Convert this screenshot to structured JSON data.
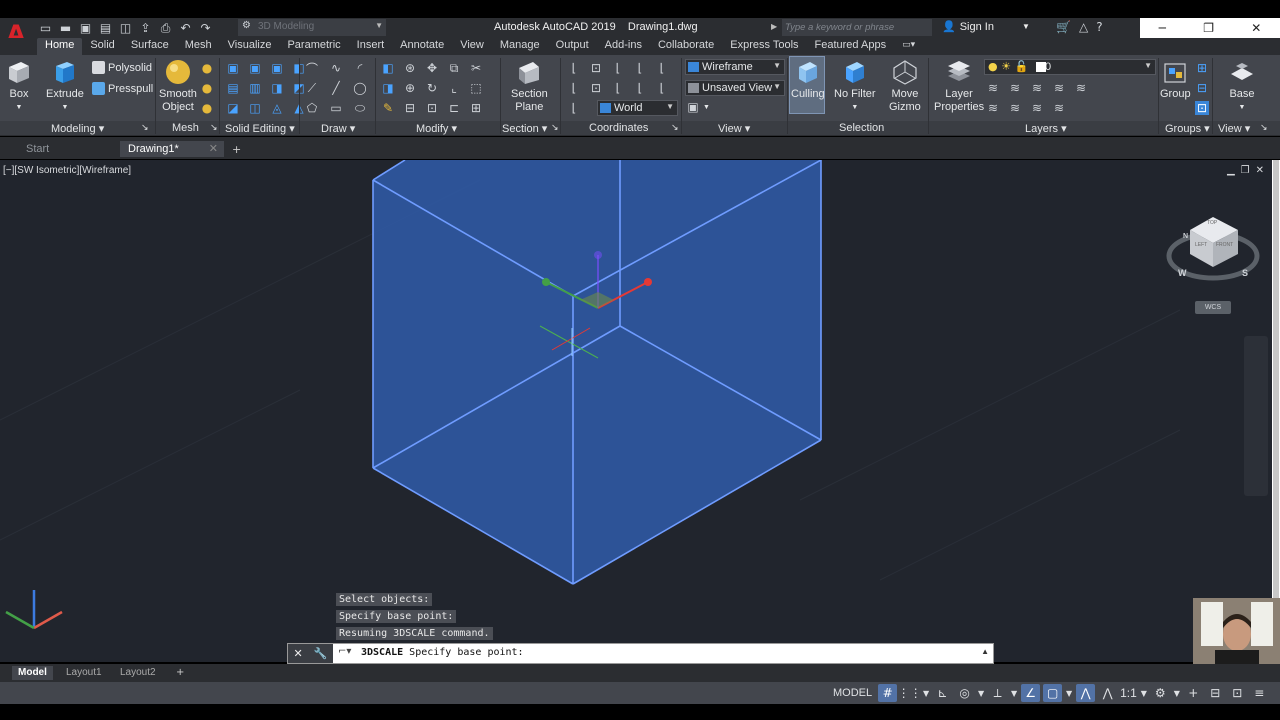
{
  "window": {
    "app_letter": "A",
    "title": "Autodesk AutoCAD 2019    Drawing1.dwg",
    "workspace": "3D Modeling",
    "search_placeholder": "Type a keyword or phrase",
    "sign_in": "Sign In"
  },
  "ribbon_tabs": [
    "Home",
    "Solid",
    "Surface",
    "Mesh",
    "Visualize",
    "Parametric",
    "Insert",
    "Annotate",
    "View",
    "Manage",
    "Output",
    "Add-ins",
    "Collaborate",
    "Express Tools",
    "Featured Apps"
  ],
  "ribbon": {
    "modeling": {
      "box": "Box",
      "extrude": "Extrude",
      "polysolid": "Polysolid",
      "presspull": "Presspull",
      "label": "Modeling ▾"
    },
    "mesh": {
      "smooth_object": "Smooth\nObject",
      "label": "Mesh"
    },
    "solid_editing": {
      "label": "Solid Editing ▾"
    },
    "draw": {
      "label": "Draw ▾"
    },
    "modify": {
      "label": "Modify ▾"
    },
    "section": {
      "section_plane": "Section\nPlane",
      "label": "Section ▾"
    },
    "coordinates": {
      "ucs": "World",
      "label": "Coordinates"
    },
    "view": {
      "visual_style": "Wireframe",
      "named_view": "Unsaved View",
      "label": "View ▾"
    },
    "selection": {
      "culling": "Culling",
      "no_filter": "No Filter",
      "move_gizmo": "Move\nGizmo",
      "label": "Selection"
    },
    "layers": {
      "layer_properties": "Layer\nProperties",
      "current_layer": "0",
      "label": "Layers ▾"
    },
    "groups": {
      "group": "Group",
      "label": "Groups ▾"
    },
    "view2": {
      "base": "Base",
      "label": "View ▾"
    }
  },
  "file_tabs": {
    "start": "Start",
    "drawing": "Drawing1*"
  },
  "viewport": {
    "label": "[−][SW Isometric][Wireframe]",
    "viewcube": {
      "top": "TOP",
      "left": "LEFT",
      "front": "FRONT",
      "west": "W",
      "south": "S",
      "north": "N",
      "wcs": "WCS"
    },
    "solid_color": "#2f5aa6",
    "edge_color": "#6f9cff"
  },
  "command": {
    "history": [
      "Select objects:",
      "Specify base point:",
      "Resuming 3DSCALE command."
    ],
    "current_command": "3DSCALE",
    "current_prompt": " Specify base point:"
  },
  "layout_tabs": [
    "Model",
    "Layout1",
    "Layout2"
  ],
  "status": {
    "model": "MODEL",
    "scale": "1:1"
  }
}
